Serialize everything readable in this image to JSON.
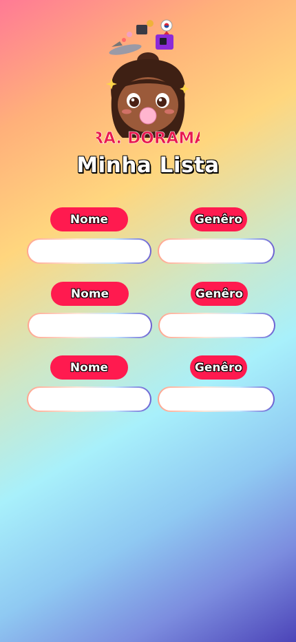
{
  "brand": {
    "logo_text": "DRA. DORAMAS"
  },
  "page": {
    "title": "Minha Lista"
  },
  "rows": [
    {
      "name_label": "Nome",
      "genre_label": "Genêro",
      "name_value": "",
      "genre_value": ""
    },
    {
      "name_label": "Nome",
      "genre_label": "Genêro",
      "name_value": "",
      "genre_value": ""
    },
    {
      "name_label": "Nome",
      "genre_label": "Genêro",
      "name_value": "",
      "genre_value": ""
    }
  ],
  "colors": {
    "pill": "#ff1a4f",
    "logo_text": "#e8194f",
    "background_top": "#ff7a95",
    "background_bottom": "#4c44b8"
  }
}
